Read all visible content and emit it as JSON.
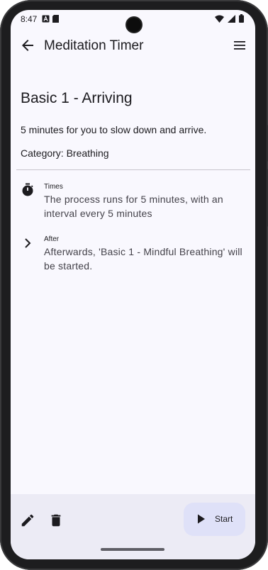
{
  "status_bar": {
    "time": "8:47",
    "left_icons": [
      "a-notification-icon",
      "sim-card-icon"
    ],
    "right_icons": [
      "wifi-icon",
      "signal-icon",
      "battery-icon"
    ]
  },
  "app_bar": {
    "title": "Meditation Timer",
    "back_icon": "arrow-back-icon",
    "menu_icon": "menu-icon"
  },
  "session": {
    "title": "Basic 1 - Arriving",
    "description": "5 minutes for you to slow down and arrive.",
    "category": "Category: Breathing"
  },
  "details": [
    {
      "icon": "timer-icon",
      "label": "Times",
      "text": "The process runs for 5 minutes, with an interval every 5 minutes"
    },
    {
      "icon": "chevron-right-icon",
      "label": "After",
      "text": "Afterwards, 'Basic 1 - Mindful Breathing' will be started."
    }
  ],
  "bottom_bar": {
    "edit_icon": "edit-icon",
    "delete_icon": "delete-icon",
    "start_label": "Start",
    "start_icon": "play-icon"
  },
  "colors": {
    "background": "#f9f8fe",
    "bottom_bar": "#ecebf5",
    "fab": "#dfe1f8",
    "text": "#1c1b1f"
  }
}
